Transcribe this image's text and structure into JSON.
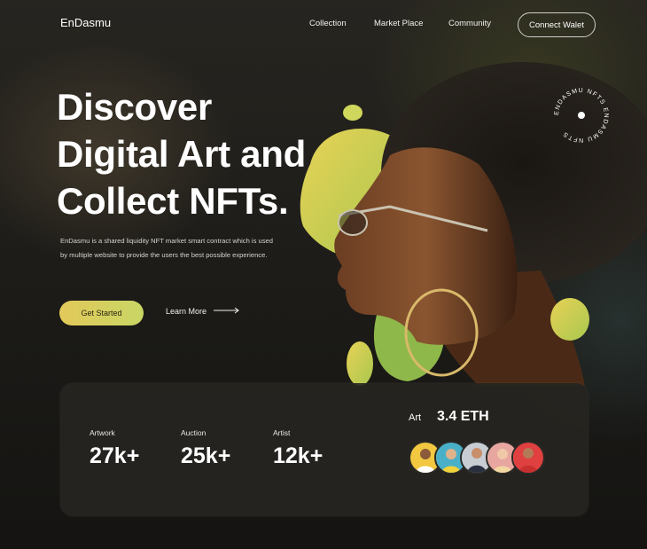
{
  "brand": "EnDasmu",
  "nav": {
    "links": [
      "Collection",
      "Market Place",
      "Community"
    ],
    "connect_label": "Connect Walet"
  },
  "hero": {
    "headline_lines": [
      "Discover",
      "Digital Art and",
      "Collect NFTs."
    ],
    "description": "EnDasmu is a shared liquidity NFT market smart contract which is used by multiple website to provide the users the best possible experience.",
    "primary_cta": "Get Started",
    "secondary_cta": "Learn More"
  },
  "badge": {
    "text": "ENDASMU NFTS ENDASMU NFTS "
  },
  "stats": [
    {
      "label": "Artwork",
      "value": "27k+"
    },
    {
      "label": "Auction",
      "value": "25k+"
    },
    {
      "label": "Artist",
      "value": "12k+"
    }
  ],
  "price": {
    "label": "Art",
    "value": "3.4 ETH"
  },
  "avatars": [
    {
      "name": "avatar-1",
      "bg": "#f2c840"
    },
    {
      "name": "avatar-2",
      "bg": "#4ab0c8"
    },
    {
      "name": "avatar-3",
      "bg": "#c8cdd4"
    },
    {
      "name": "avatar-4",
      "bg": "#e8a6a0"
    },
    {
      "name": "avatar-5",
      "bg": "#e04040"
    }
  ],
  "colors": {
    "accent_yellow": "#e3c95a",
    "accent_lime": "#c8d665",
    "background": "#1b1a17",
    "panel": "#262521"
  }
}
